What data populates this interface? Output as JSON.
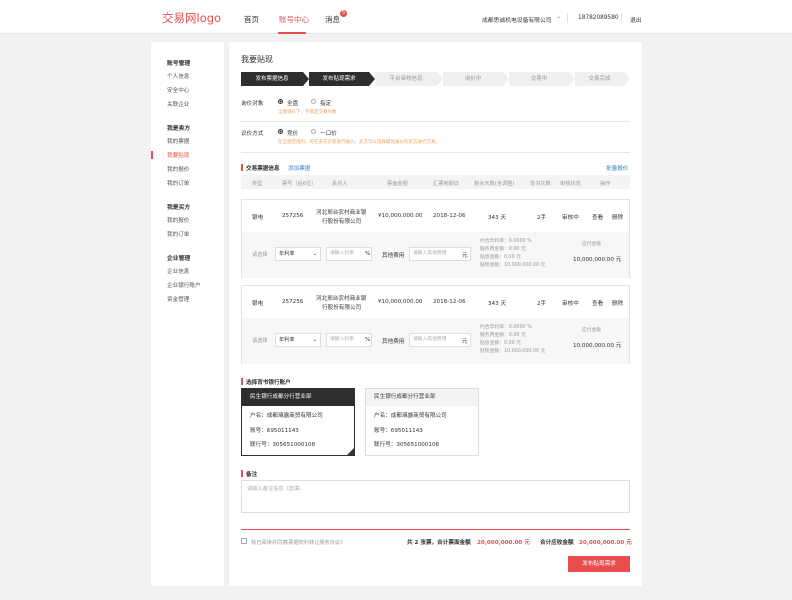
{
  "header": {
    "logo": "交易网logo",
    "nav": [
      {
        "label": "首页",
        "active": false
      },
      {
        "label": "账号中心",
        "active": true
      },
      {
        "label": "消息",
        "active": false
      }
    ],
    "message_badge": "5",
    "company": "成都思诚机电设备有限公司",
    "phone": "18782089580",
    "logout": "退出"
  },
  "sidebar": {
    "groups": [
      {
        "title": "账号管理",
        "items": [
          "个人信息",
          "安全中心",
          "关联企业"
        ]
      },
      {
        "title": "我是卖方",
        "items": [
          "我的票据",
          "我要贴现",
          "我的报价",
          "我的订单"
        ]
      },
      {
        "title": "我是买方",
        "items": [
          "我的报价",
          "我的订单"
        ]
      },
      {
        "title": "企业管理",
        "items": [
          "企业信息",
          "企业银行账户",
          "资金管理"
        ]
      }
    ],
    "active_item": "我要贴现"
  },
  "main": {
    "title": "我要贴现",
    "steps": [
      "发布票据信息",
      "发布贴现需求",
      "平台审核信息",
      "询价中",
      "交易中",
      "交易完成"
    ],
    "inquiry_target": {
      "label": "询价对象",
      "options": [
        "全盘",
        "指定"
      ],
      "selected": "全盘",
      "hint": "全盘询价下，不限定交易对象"
    },
    "quote_method": {
      "label": "议价方式",
      "options": [
        "竞价",
        "一口价"
      ],
      "selected": "竞价",
      "hint": "在全盘范围内，可在多方买家进行报价，卖方可以选择最优报价的买方进行交易。"
    },
    "bills_section": {
      "title": "交易票据信息",
      "add_link": "添加票据",
      "batch_link": "批量报价",
      "headers": [
        "类型",
        "票号（后6位）",
        "承兑人",
        "票面金额",
        "汇票到期日",
        "剩余天数(含调整)",
        "背书次数",
        "审核状态",
        "操作"
      ],
      "rows": [
        {
          "type": "银电",
          "bill_no": "257256",
          "acceptor_line1": "河北邢台农村商业银",
          "acceptor_line2": "行股份有限公司",
          "amount": "¥10,000,000.00",
          "due": "2018-12-06",
          "days": "343 天",
          "endorse": "2手",
          "status": "审核中",
          "op_view": "查看",
          "op_delete": "删除",
          "sel_label": "请选择",
          "rate_type": "年利率",
          "rate_placeholder": "请输入利率",
          "rate_unit": "%",
          "other_fee_label": "其他费用",
          "other_fee_placeholder": "请输入其他费用",
          "fee_unit": "元",
          "summary": [
            "约合年利率：0.0000 %",
            "服务费金额：0.00 元",
            "贴息金额：0.00 元",
            "贴现金额：10,000,000.00 元"
          ],
          "settle_label": "应付金额",
          "settle_value": "10,000,000.00 元"
        },
        {
          "type": "银电",
          "bill_no": "257256",
          "acceptor_line1": "河北邢台农村商业银",
          "acceptor_line2": "行股份有限公司",
          "amount": "¥10,000,000.00",
          "due": "2018-12-06",
          "days": "343 天",
          "endorse": "2手",
          "status": "审核中",
          "op_view": "查看",
          "op_delete": "删除",
          "sel_label": "请选择",
          "rate_type": "年利率",
          "rate_placeholder": "请输入利率",
          "rate_unit": "%",
          "other_fee_label": "其他费用",
          "other_fee_placeholder": "请输入其他费用",
          "fee_unit": "元",
          "summary": [
            "约合年利率：0.0000 %",
            "服务费金额：0.00 元",
            "贴息金额：0.00 元",
            "贴现金额：10,000,000.00 元"
          ],
          "settle_label": "应付金额",
          "settle_value": "10,000,000.00 元"
        }
      ]
    },
    "bank_section": {
      "title": "选择背书银行账户",
      "accounts": [
        {
          "name": "民生银行成都分行营业部",
          "holder": "户名：成都璃露商贸有限公司",
          "account": "账号：695011143",
          "line": "联行号：305651000108",
          "selected": true
        },
        {
          "name": "民生银行成都分行营业部",
          "holder": "户名：成都璃露商贸有限公司",
          "account": "账号：695011143",
          "line": "联行号：305651000108",
          "selected": false
        }
      ]
    },
    "remarks": {
      "title": "备注",
      "placeholder": "请输入备注信息（选填）"
    },
    "footer": {
      "agree_prefix": "我已阅读并同意",
      "agree_link": "《票据权利转让服务协议》",
      "total_label": "共 2 张票，合计票面金额",
      "total_value": "20,000,000.00 元",
      "receive_label": "合计应收金额",
      "receive_value": "20,000,000.00 元",
      "submit": "发布贴现需求"
    }
  },
  "colors": {
    "accent": "#e84e4e",
    "dark": "#2e2e2e",
    "link": "#3b82c4",
    "hint": "#e8a05a"
  }
}
